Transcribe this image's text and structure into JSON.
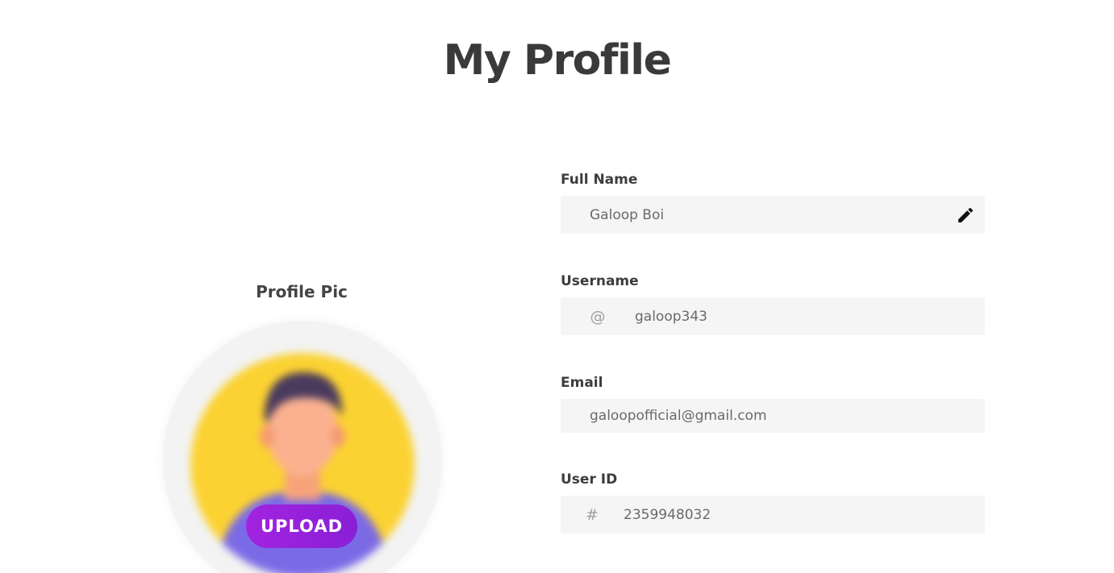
{
  "page": {
    "title": "My Profile"
  },
  "profile_pic": {
    "label": "Profile Pic",
    "upload_label": "UPLOAD",
    "avatar_icon": "person-avatar"
  },
  "form": {
    "full_name": {
      "label": "Full Name",
      "value": "Galoop Boi",
      "edit_icon": "pencil-icon"
    },
    "username": {
      "label": "Username",
      "prefix": "@",
      "value": "galoop343"
    },
    "email": {
      "label": "Email",
      "value": "galoopofficial@gmail.com"
    },
    "user_id": {
      "label": "User ID",
      "prefix": "#",
      "value": "2359948032"
    }
  },
  "colors": {
    "accent": "#9b21dd",
    "title_text": "#3a3a3a",
    "field_bg": "#f5f5f5",
    "avatar_bg": "#fbd232"
  }
}
